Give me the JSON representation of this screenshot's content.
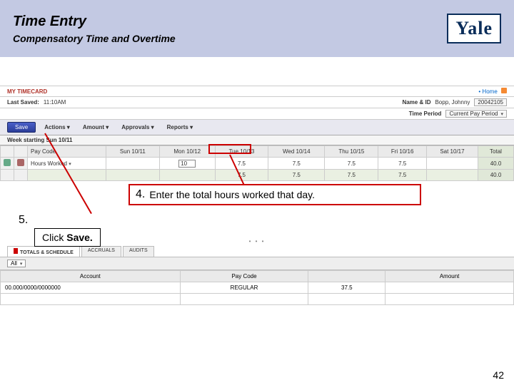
{
  "header": {
    "title": "Time Entry",
    "subtitle": "Compensatory Time and Overtime",
    "logo": "Yale"
  },
  "top": {
    "card_title": "MY TIMECARD",
    "home": "Home",
    "last_saved_label": "Last Saved:",
    "last_saved_value": "11:10AM",
    "name_label": "Name & ID",
    "name_value": "Bopp, Johnny",
    "id_value": "20042105",
    "period_label": "Time Period",
    "period_value": "Current Pay Period"
  },
  "toolbar": {
    "save": "Save",
    "menus": [
      "Actions ▾",
      "Amount ▾",
      "Approvals ▾",
      "Reports ▾"
    ]
  },
  "week": {
    "label": "Week starting Sun 10/11"
  },
  "grid": {
    "paycode_header": "Pay Code",
    "days": [
      "Sun 10/11",
      "Mon 10/12",
      "Tue 10/13",
      "Wed 10/14",
      "Thu 10/15",
      "Fri 10/16",
      "Sat 10/17"
    ],
    "total_header": "Total",
    "row1": {
      "paycode": "Hours Worked",
      "mon": "10",
      "tue": "7.5",
      "wed": "7.5",
      "thu": "7.5",
      "fri": "7.5",
      "total": "40.0"
    },
    "row2": {
      "tue": "7.5",
      "wed": "7.5",
      "thu": "7.5",
      "fri": "7.5",
      "total": "40.0"
    }
  },
  "steps": {
    "s4_num": "4.",
    "s4_text": "Enter the total hours worked that day.",
    "s5_num": "5.",
    "s5_text_a": "Click ",
    "s5_text_b": "Save."
  },
  "bottom": {
    "tabs": [
      "TOTALS & SCHEDULE",
      "ACCRUALS",
      "AUDITS"
    ],
    "filter": "All",
    "headers": [
      "Account",
      "Pay Code",
      "",
      "Amount"
    ],
    "row": {
      "account": "00.000/0000/0000000",
      "paycode": "REGULAR",
      "val": "37.5",
      "amount": ""
    }
  },
  "page_num": "42"
}
